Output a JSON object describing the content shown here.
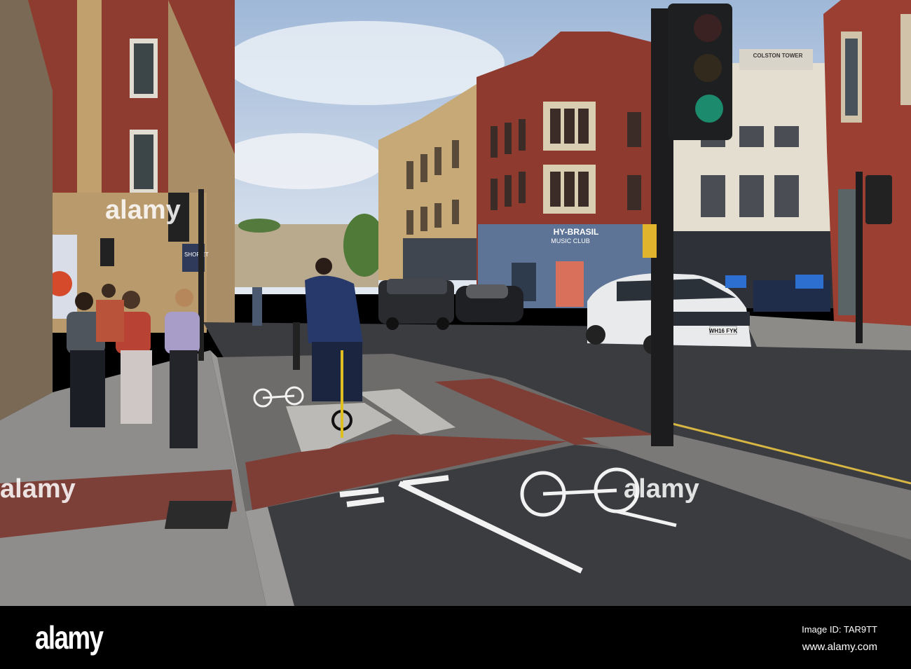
{
  "photo": {
    "watermark": "alamy",
    "signs": {
      "club_name": "HY-BRASIL",
      "club_sub": "MUSIC CLUB",
      "tower": "COLSTON TOWER",
      "agent_left": "SHOP",
      "agent_right": "LET",
      "plate_white_car": "WH16 FYK"
    }
  },
  "footer": {
    "logo": "alamy",
    "image_id": "Image ID: TAR9TT",
    "website": "www.alamy.com"
  },
  "colors": {
    "sky": "#c9d8ea",
    "brick": "#8e3a2e",
    "stone": "#c2a274",
    "road": "#3a3b3e",
    "paving": "#8c8a88",
    "red_paving": "#7a3c35"
  }
}
